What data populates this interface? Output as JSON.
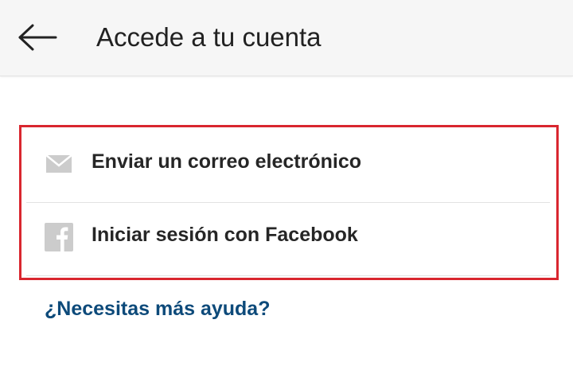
{
  "header": {
    "title": "Accede a tu cuenta",
    "back_icon": "arrow-left-icon"
  },
  "options": [
    {
      "label": "Enviar un correo electrónico",
      "icon": "envelope-icon"
    },
    {
      "label": "Iniciar sesión con Facebook",
      "icon": "facebook-icon"
    }
  ],
  "help_link": "¿Necesitas más ayuda?",
  "colors": {
    "highlight_border": "#d9262f",
    "link": "#0d4a7a",
    "icon_gray": "#cccccc",
    "topbar_bg": "#f6f6f6"
  }
}
